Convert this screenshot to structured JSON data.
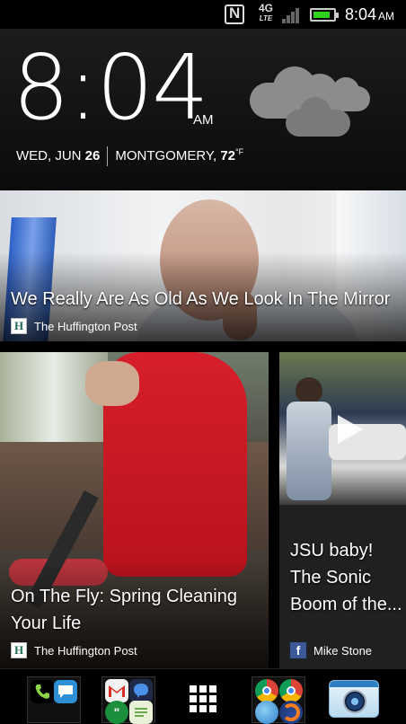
{
  "status_bar": {
    "network_badge": "4G",
    "network_sub": "LTE",
    "time": "8:04",
    "ampm": "AM",
    "signal_bars_filled": 0,
    "battery_level": 0.85,
    "battery_color": "#2fd11b",
    "icons": [
      "nfc-icon",
      "lte-icon",
      "signal-icon",
      "battery-icon"
    ]
  },
  "clock": {
    "time": "8:04",
    "ampm": "AM",
    "weekday_month": "WED, JUN",
    "day": "26",
    "city": "MONTGOMERY,",
    "temp": "72",
    "unit": "°F",
    "weather_icon": "cloudy-icon"
  },
  "feed": {
    "items": [
      {
        "title": "We Really Are As Old As We Look In The Mirror",
        "source": "The Huffington Post",
        "source_icon": "H"
      },
      {
        "title_line1": "On The Fly: Spring Cleaning",
        "title_line2": "Your Life",
        "source": "The Huffington Post",
        "source_icon": "H"
      },
      {
        "title_line1": "JSU baby!",
        "title_line2": "The Sonic",
        "title_line3": "Boom of the...",
        "source": "Mike Stone",
        "source_icon": "f",
        "has_video": true
      }
    ]
  },
  "dock": {
    "items": [
      "phone-messages-folder",
      "email-gmail-folder",
      "all-apps-button",
      "browsers-folder",
      "camera-app"
    ]
  },
  "colors": {
    "facebook": "#3b5998",
    "huffpost": "#1f6b55"
  }
}
